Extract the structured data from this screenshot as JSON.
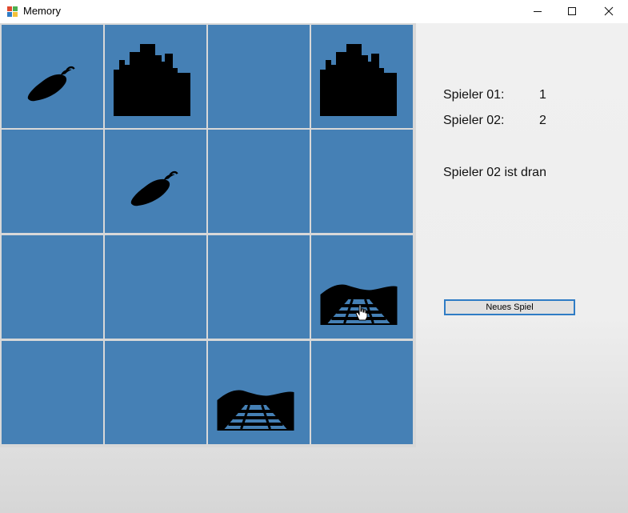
{
  "window": {
    "title": "Memory",
    "icons": {
      "app": "windows-app-icon",
      "minimize": "minimize-icon",
      "maximize": "maximize-icon",
      "close": "close-icon"
    }
  },
  "board": {
    "rows": 4,
    "cols": 4,
    "tile_color": "#4580b5",
    "tiles": [
      [
        "chili-pepper",
        "city-skyline",
        "hidden",
        "city-skyline"
      ],
      [
        "hidden",
        "chili-pepper",
        "hidden",
        "hidden"
      ],
      [
        "hidden",
        "hidden",
        "hidden",
        "railway-track"
      ],
      [
        "hidden",
        "hidden",
        "railway-track",
        "hidden"
      ]
    ]
  },
  "scores": {
    "player1_label": "Spieler 01:",
    "player1_score": "1",
    "player2_label": "Spieler 02:",
    "player2_score": "2"
  },
  "status": "Spieler 02 ist dran",
  "new_game_label": "Neues Spiel",
  "cursor": "hand-pointer-icon"
}
